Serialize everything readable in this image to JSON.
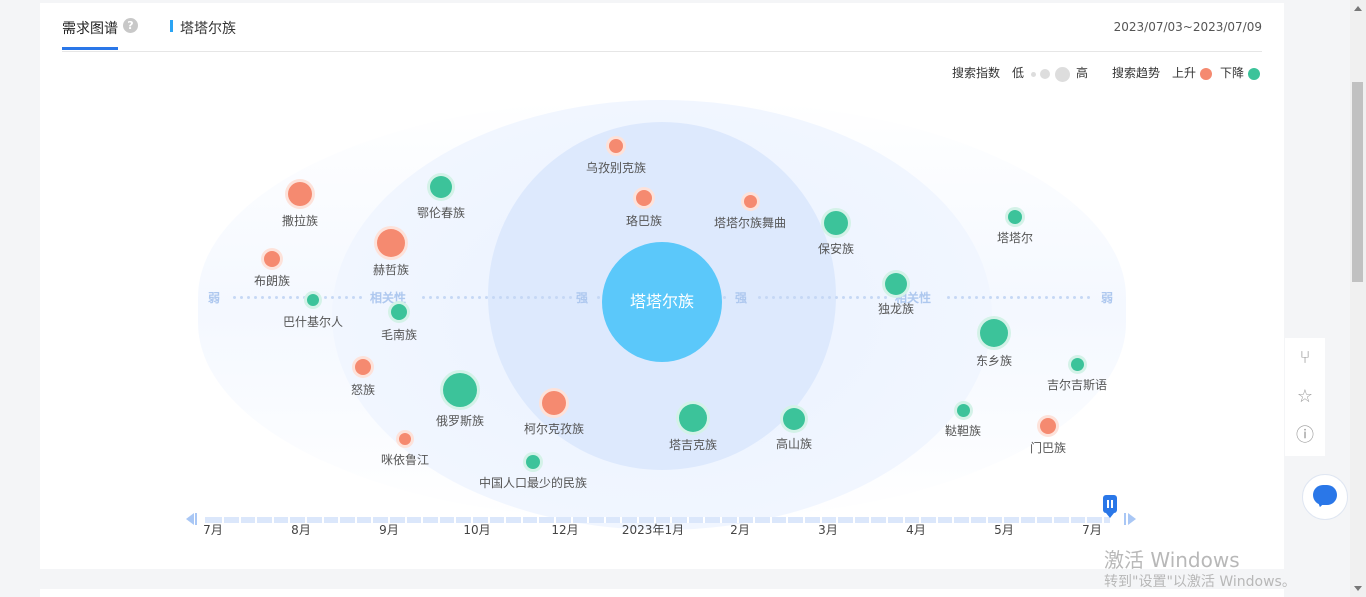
{
  "header": {
    "tab_title": "需求图谱",
    "help_icon": "question-circle-icon",
    "sub_title": "塔塔尔族",
    "date_range": "2023/07/03~2023/07/09"
  },
  "legend": {
    "search_index_label": "搜索指数",
    "low_label": "低",
    "high_label": "高",
    "search_trend_label": "搜索趋势",
    "up_label": "上升",
    "down_label": "下降",
    "up_color": "#f58a70",
    "down_color": "#3cc39a"
  },
  "graph": {
    "center_word": "塔塔尔族",
    "axis": {
      "weak_left": "弱",
      "relevance_left": "相关性",
      "strong_left": "强",
      "strong_right": "强",
      "relevance_right": "相关性",
      "weak_right": "弱"
    },
    "words": [
      {
        "label": "乌孜别克族",
        "trend": "up"
      },
      {
        "label": "撒拉族",
        "trend": "up"
      },
      {
        "label": "鄂伦春族",
        "trend": "down"
      },
      {
        "label": "珞巴族",
        "trend": "up"
      },
      {
        "label": "塔塔尔族舞曲",
        "trend": "up"
      },
      {
        "label": "保安族",
        "trend": "down"
      },
      {
        "label": "塔塔尔",
        "trend": "down"
      },
      {
        "label": "布朗族",
        "trend": "up"
      },
      {
        "label": "赫哲族",
        "trend": "up"
      },
      {
        "label": "巴什基尔人",
        "trend": "down"
      },
      {
        "label": "毛南族",
        "trend": "down"
      },
      {
        "label": "独龙族",
        "trend": "down"
      },
      {
        "label": "东乡族",
        "trend": "down"
      },
      {
        "label": "吉尔吉斯语",
        "trend": "down"
      },
      {
        "label": "怒族",
        "trend": "up"
      },
      {
        "label": "俄罗斯族",
        "trend": "down"
      },
      {
        "label": "柯尔克孜族",
        "trend": "up"
      },
      {
        "label": "塔吉克族",
        "trend": "down"
      },
      {
        "label": "高山族",
        "trend": "down"
      },
      {
        "label": "鞑靼族",
        "trend": "down"
      },
      {
        "label": "门巴族",
        "trend": "up"
      },
      {
        "label": "咪依鲁江",
        "trend": "up"
      },
      {
        "label": "中国人口最少的民族",
        "trend": "down"
      }
    ]
  },
  "timeline": {
    "labels": [
      "7月",
      "8月",
      "9月",
      "10月",
      "12月",
      "2023年1月",
      "2月",
      "3月",
      "4月",
      "5月",
      "7月"
    ]
  },
  "side_tools": [
    "share-icon",
    "star-icon",
    "help-icon"
  ],
  "watermark": {
    "line1": "激活 Windows",
    "line2": "转到\"设置\"以激活 Windows。"
  }
}
